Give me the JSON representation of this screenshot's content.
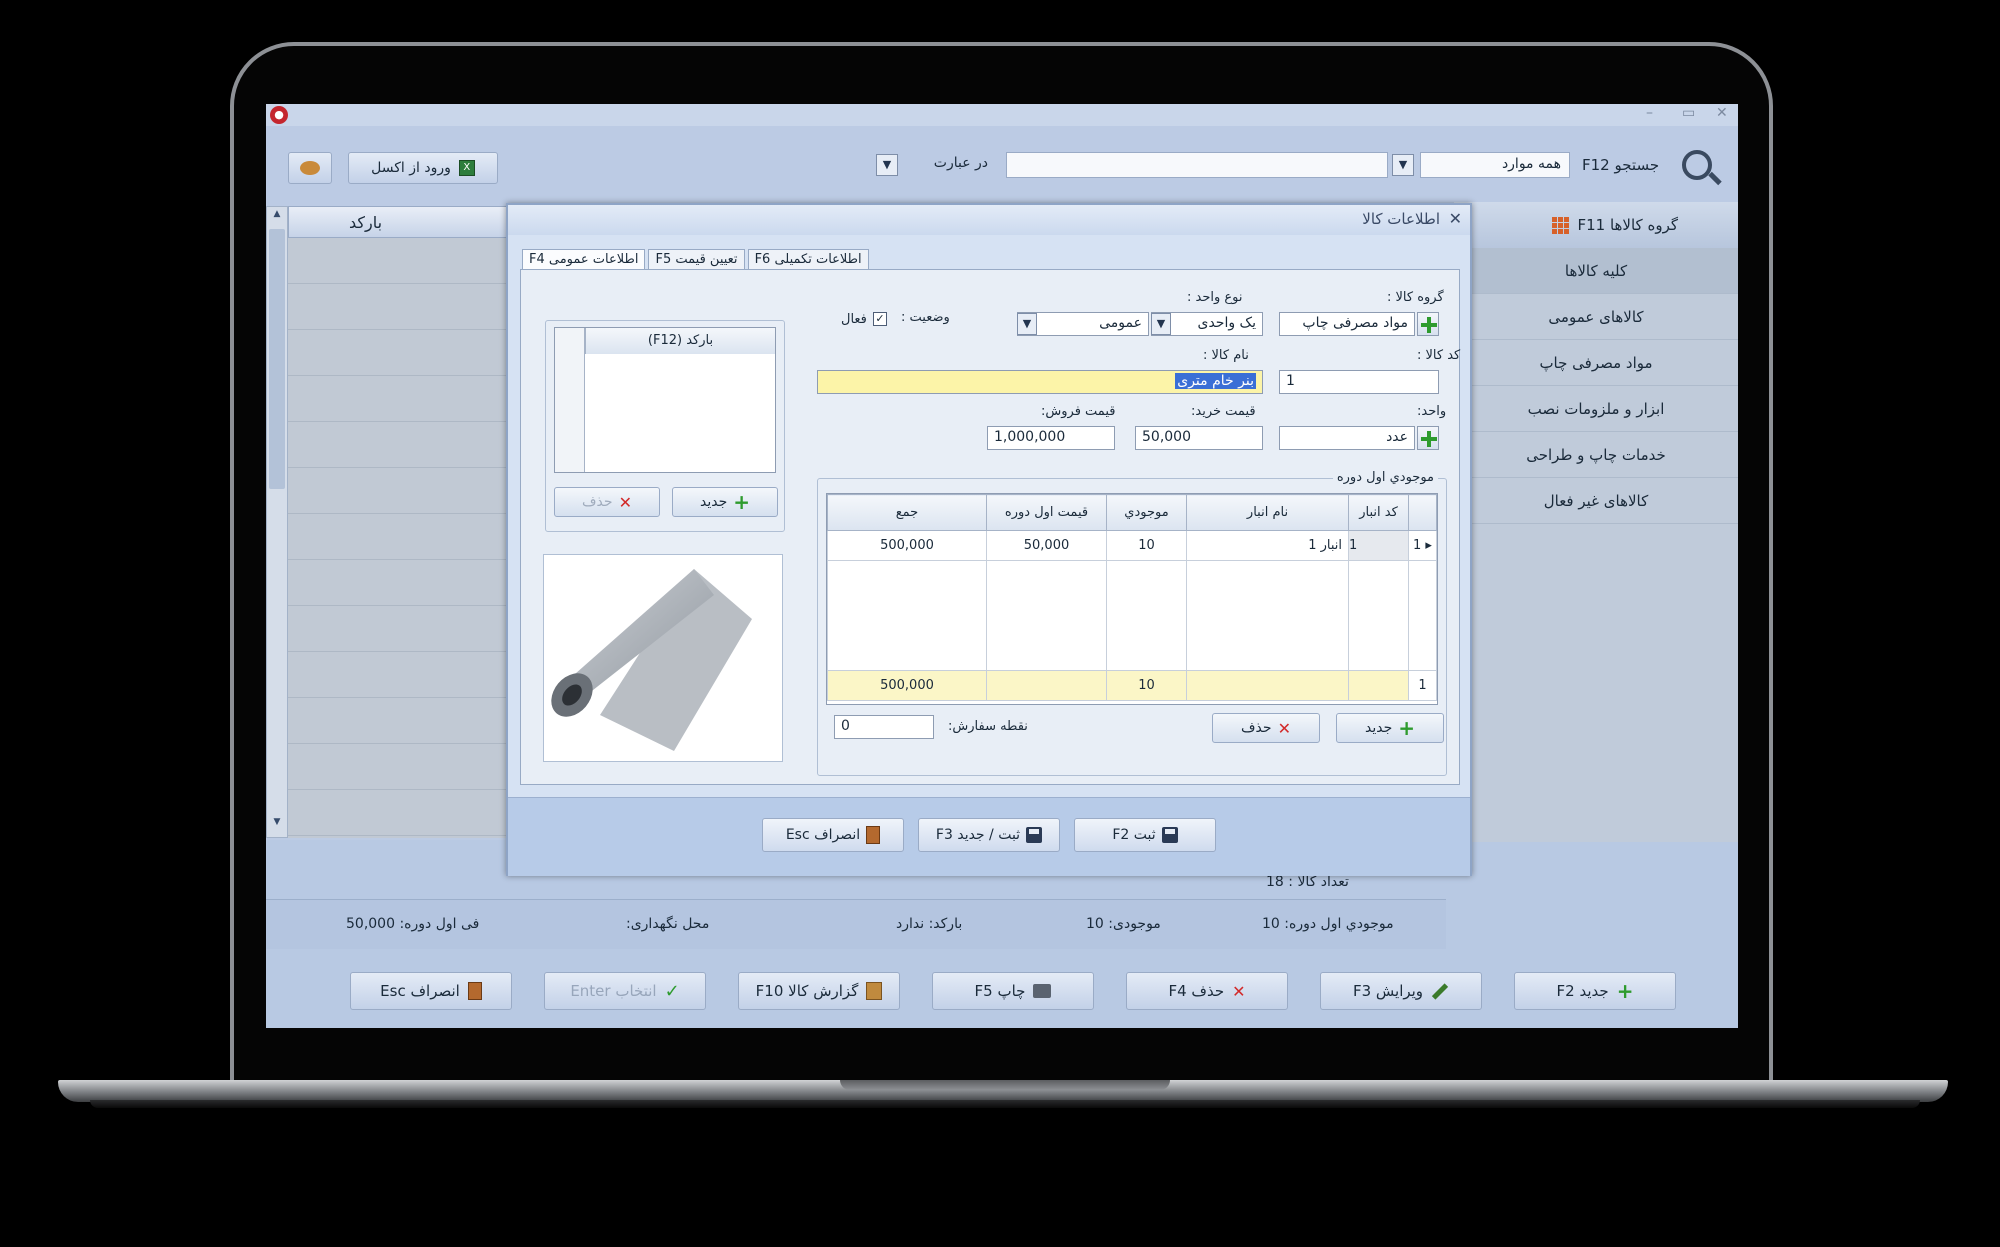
{
  "toolbar": {
    "search_label": "جستجو F12",
    "scope_value": "همه موارد",
    "search_text": "",
    "match_value": "در عبارت",
    "import_excel_label": "ورود از اکسل"
  },
  "grid": {
    "barcode_column": "بارکد"
  },
  "groups": {
    "header": "گروه کالاها F11",
    "items": [
      "کلیه کالاها",
      "کالاهای عمومی",
      "مواد مصرفی چاپ",
      "ابزار و ملزومات نصب",
      "خدمات چاپ و طراحی",
      "کالاهای غیر فعال"
    ]
  },
  "count_text": "تعداد کالا : 18",
  "info_bar": {
    "opening_stock": "موجودي اول دوره: 10",
    "stock": "موجودی: 10",
    "barcode": "بارکد: ندارد",
    "location": "محل نگهداری:",
    "opening_price": "فی اول دوره: 50,000"
  },
  "bottom_buttons": {
    "new": "جدید F2",
    "edit": "ویرایش F3",
    "delete": "حذف F4",
    "print": "چاپ F5",
    "report": "گزارش کالا F10",
    "select": "انتخاب Enter",
    "cancel": "انصراف Esc"
  },
  "dialog": {
    "title": "اطلاعات کالا",
    "tabs": [
      "اطلاعات عمومی F4",
      "تعیین قیمت F5",
      "اطلاعات تکمیلی F6"
    ],
    "group_label": "گروه کالا :",
    "group_value": "مواد مصرفی چاپ",
    "unit_type_label": "نوع واحد :",
    "unit_type_value": "یک واحدی",
    "unit_scope_value": "عمومی",
    "status_label": "وضعیت :",
    "active_label": "فعال",
    "code_label": "کد کالا :",
    "code_value": "1",
    "name_label": "نام کالا :",
    "name_value": "بنر خام متری",
    "unit_label": "واحد:",
    "unit_value": "عدد",
    "buy_price_label": "قیمت خرید:",
    "buy_price_value": "50,000",
    "sell_price_label": "قیمت فروش:",
    "sell_price_value": "1,000,000",
    "opening_title": "موجودي اول دوره",
    "table": {
      "headers": [
        "کد انبار",
        "نام انبار",
        "موجودي",
        "قیمت اول دوره",
        "جمع"
      ],
      "rows": [
        {
          "rownum": "1",
          "code": "1",
          "name": "انبار 1",
          "qty": "10",
          "price": "50,000",
          "total": "500,000"
        }
      ],
      "total_row": {
        "rownum": "1",
        "qty": "10",
        "total": "500,000"
      }
    },
    "new_label": "جدید",
    "delete_label": "حذف",
    "reorder_label": "نقطه سفارش:",
    "reorder_value": "0",
    "barcode_header": "بارکد (F12)",
    "barcode_new": "جدید",
    "barcode_delete": "حذف",
    "footer": {
      "save": "ثبت F2",
      "save_new": "ثبت / جدید F3",
      "cancel": "انصراف Esc"
    }
  },
  "colors": {
    "accent": "#2e9b2e",
    "danger": "#d22a2a",
    "highlight": "#fcf4a8"
  }
}
